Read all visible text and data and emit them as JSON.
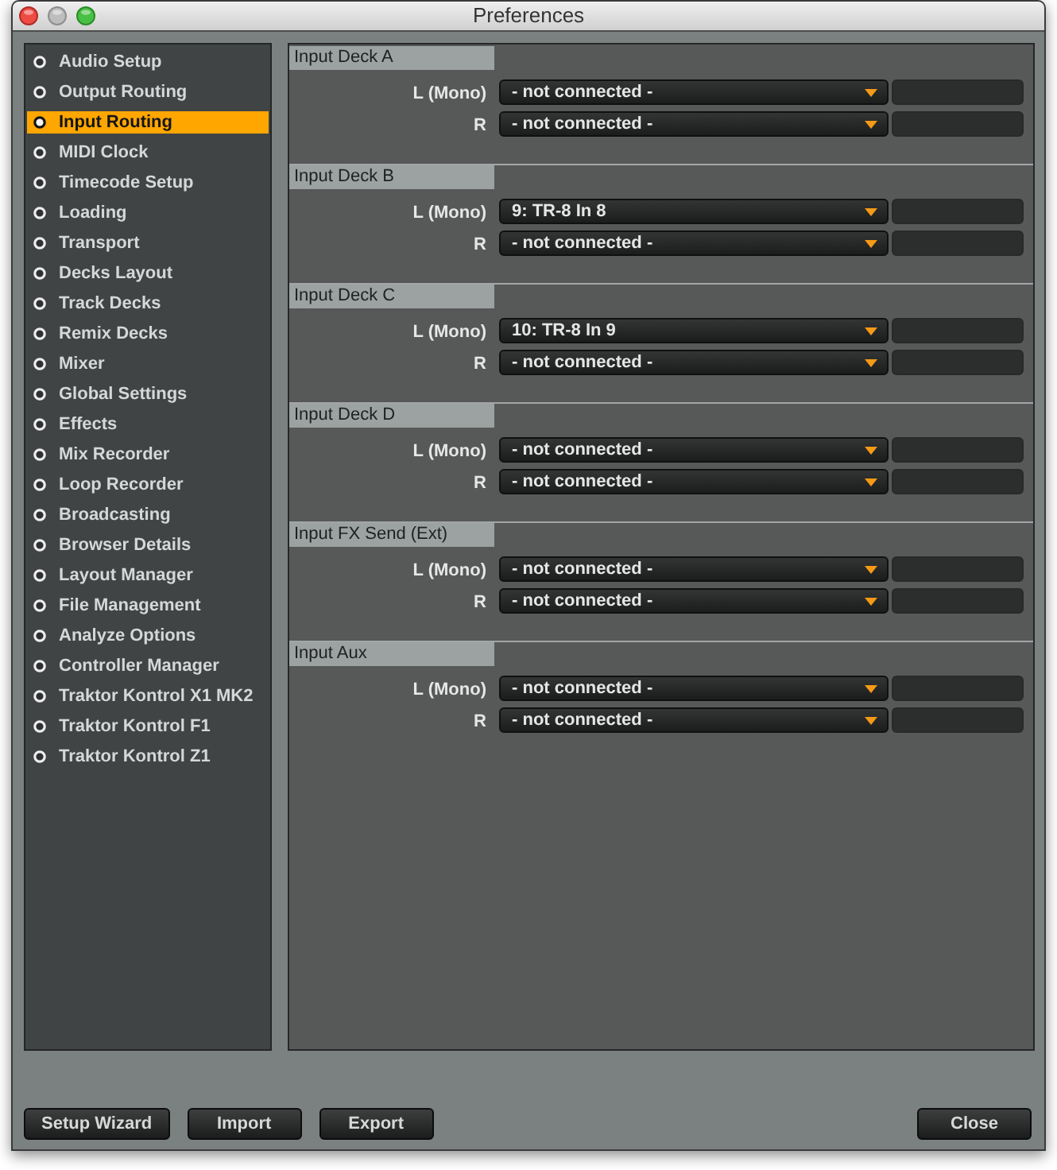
{
  "window": {
    "title": "Preferences"
  },
  "sidebar": {
    "items": [
      {
        "label": "Audio Setup",
        "selected": false
      },
      {
        "label": "Output Routing",
        "selected": false
      },
      {
        "label": "Input Routing",
        "selected": true
      },
      {
        "label": "MIDI Clock",
        "selected": false
      },
      {
        "label": "Timecode Setup",
        "selected": false
      },
      {
        "label": "Loading",
        "selected": false
      },
      {
        "label": "Transport",
        "selected": false
      },
      {
        "label": "Decks Layout",
        "selected": false
      },
      {
        "label": "Track Decks",
        "selected": false
      },
      {
        "label": "Remix Decks",
        "selected": false
      },
      {
        "label": "Mixer",
        "selected": false
      },
      {
        "label": "Global Settings",
        "selected": false
      },
      {
        "label": "Effects",
        "selected": false
      },
      {
        "label": "Mix Recorder",
        "selected": false
      },
      {
        "label": "Loop Recorder",
        "selected": false
      },
      {
        "label": "Broadcasting",
        "selected": false
      },
      {
        "label": "Browser Details",
        "selected": false
      },
      {
        "label": "Layout Manager",
        "selected": false
      },
      {
        "label": "File Management",
        "selected": false
      },
      {
        "label": "Analyze Options",
        "selected": false
      },
      {
        "label": "Controller Manager",
        "selected": false
      },
      {
        "label": "Traktor Kontrol X1 MK2",
        "selected": false
      },
      {
        "label": "Traktor Kontrol F1",
        "selected": false
      },
      {
        "label": "Traktor Kontrol Z1",
        "selected": false
      }
    ]
  },
  "sections": [
    {
      "title": "Input Deck A",
      "channels": [
        {
          "label": "L (Mono)",
          "value": "- not connected -"
        },
        {
          "label": "R",
          "value": "- not connected -"
        }
      ]
    },
    {
      "title": "Input Deck B",
      "channels": [
        {
          "label": "L (Mono)",
          "value": "9: TR-8 In 8"
        },
        {
          "label": "R",
          "value": "- not connected -"
        }
      ]
    },
    {
      "title": "Input Deck C",
      "channels": [
        {
          "label": "L (Mono)",
          "value": "10: TR-8 In 9"
        },
        {
          "label": "R",
          "value": "- not connected -"
        }
      ]
    },
    {
      "title": "Input Deck D",
      "channels": [
        {
          "label": "L (Mono)",
          "value": "- not connected -"
        },
        {
          "label": "R",
          "value": "- not connected -"
        }
      ]
    },
    {
      "title": "Input FX Send (Ext)",
      "channels": [
        {
          "label": "L (Mono)",
          "value": "- not connected -"
        },
        {
          "label": "R",
          "value": "- not connected -"
        }
      ]
    },
    {
      "title": "Input Aux",
      "channels": [
        {
          "label": "L (Mono)",
          "value": "- not connected -"
        },
        {
          "label": "R",
          "value": "- not connected -"
        }
      ]
    }
  ],
  "footer": {
    "left_buttons": [
      "Setup Wizard",
      "Import",
      "Export"
    ],
    "right_buttons": [
      "Close"
    ]
  }
}
